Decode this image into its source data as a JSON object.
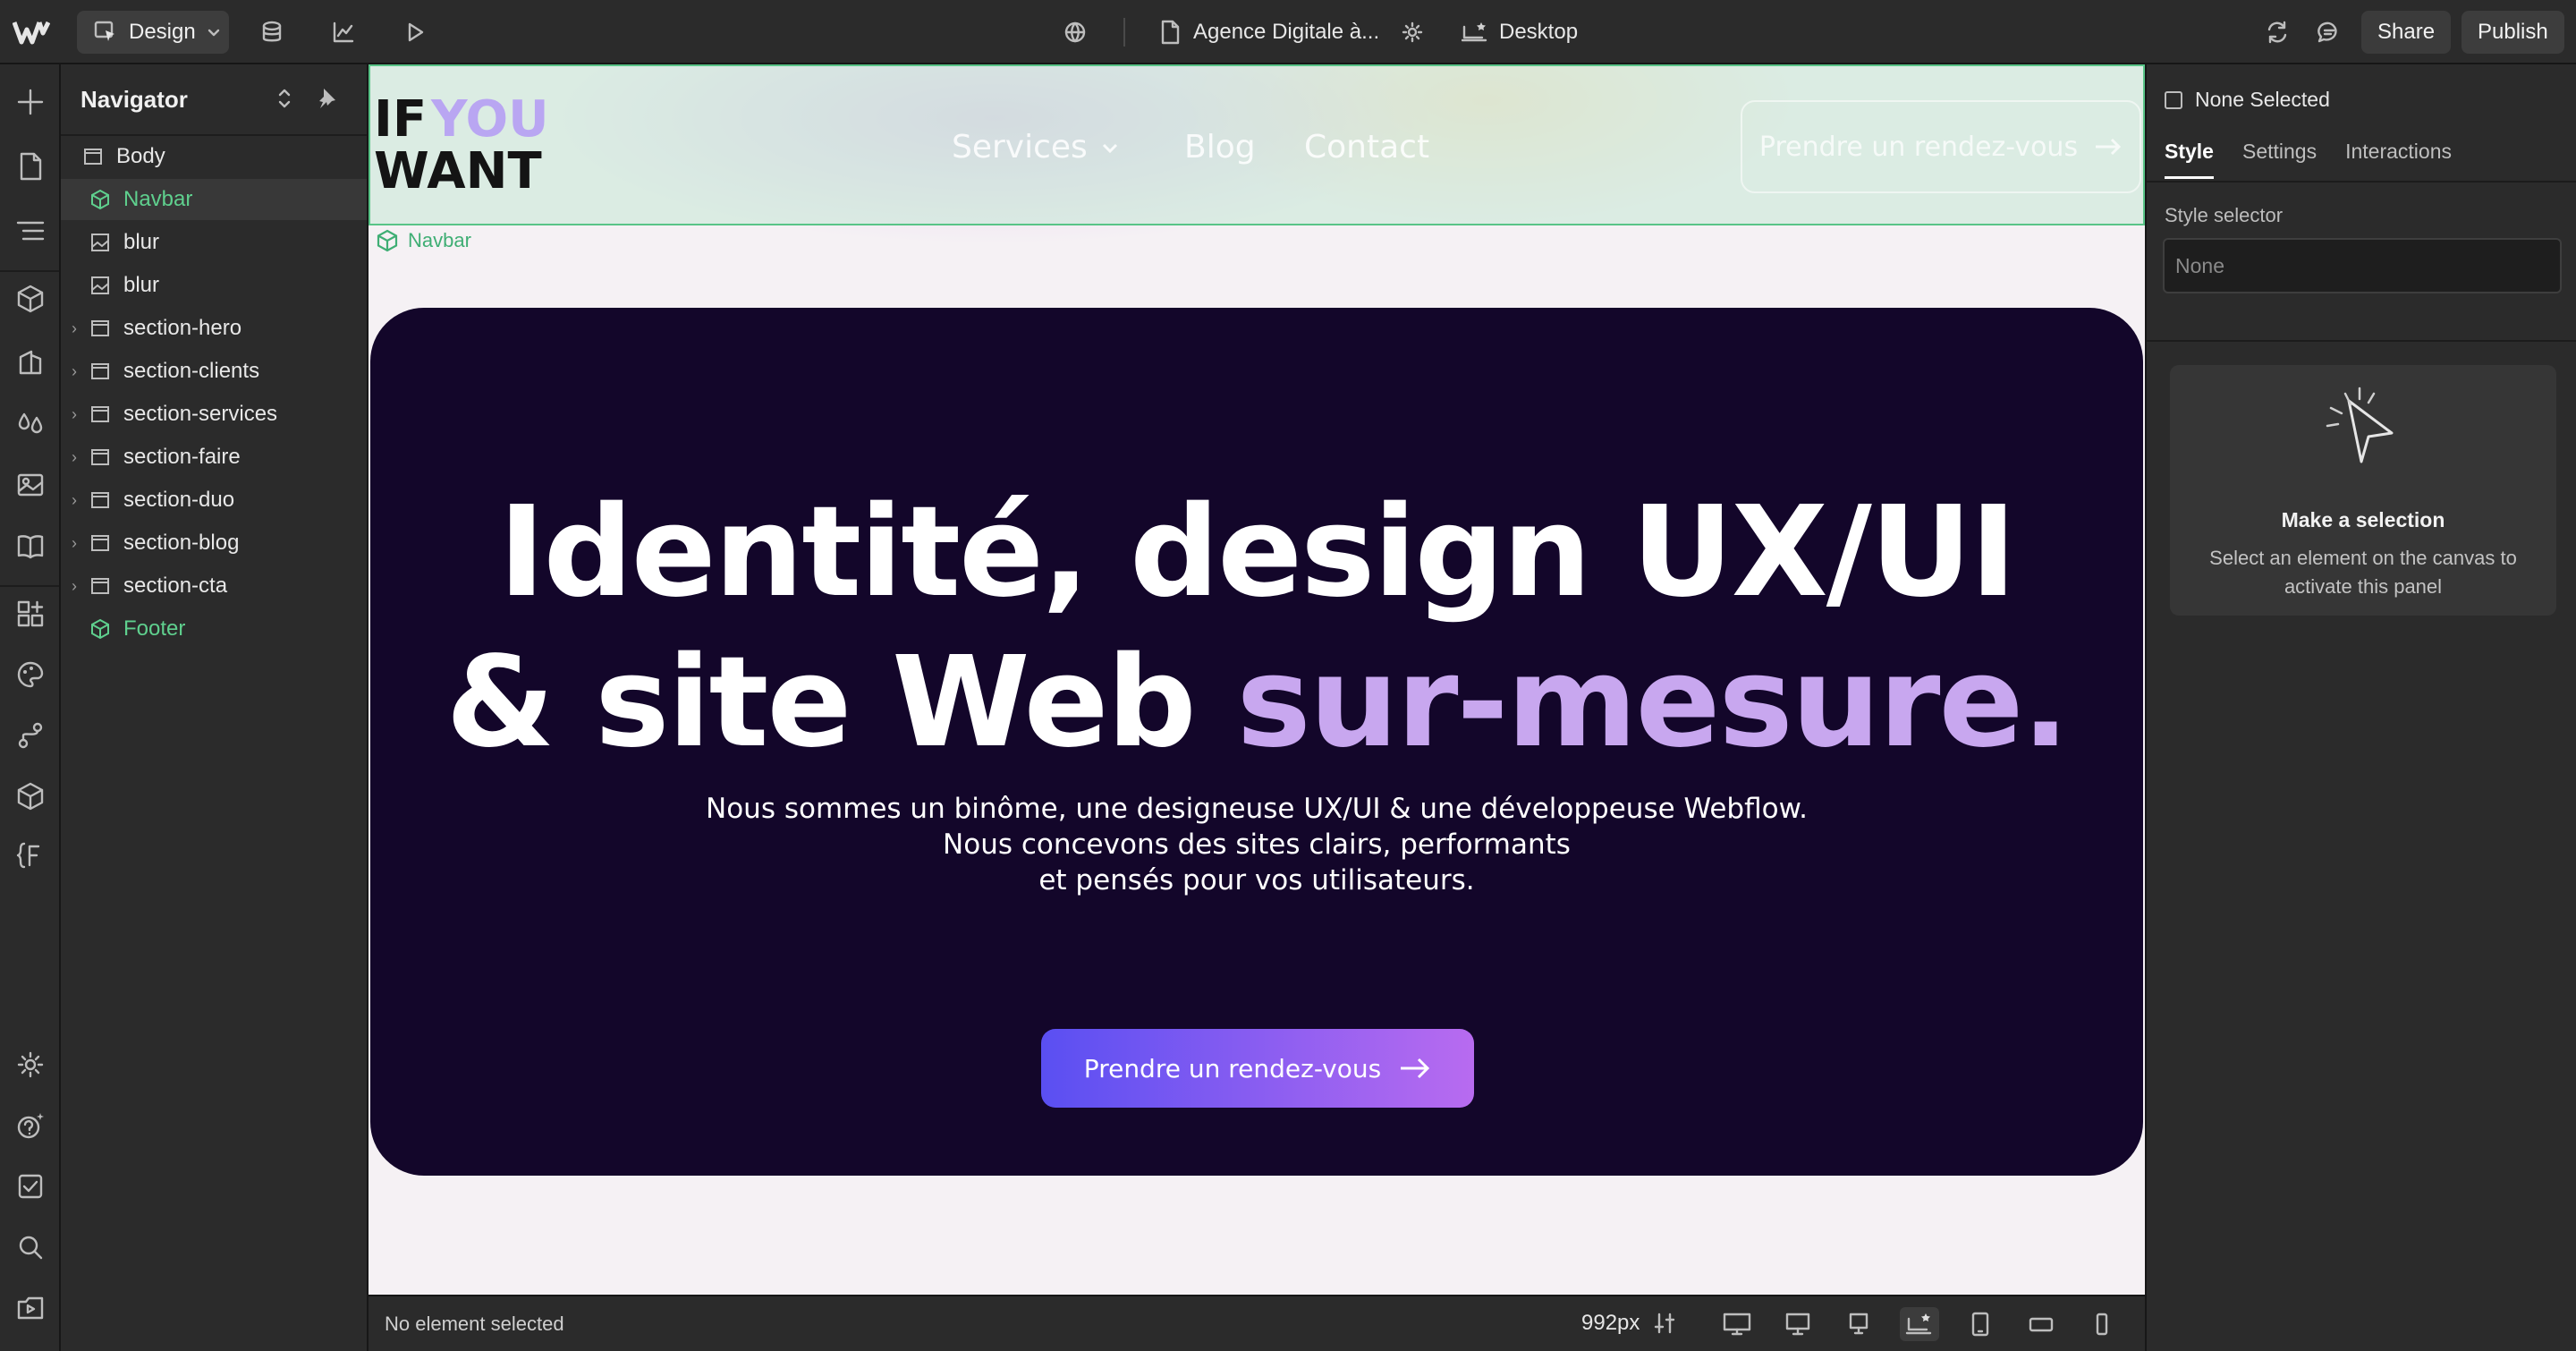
{
  "topbar": {
    "mode_label": "Design",
    "page_name": "Agence Digitale à...",
    "breakpoint_label": "Desktop",
    "share_label": "Share",
    "publish_label": "Publish"
  },
  "navigator": {
    "title": "Navigator",
    "items": [
      {
        "label": "Body",
        "type": "box",
        "expandable": false
      },
      {
        "label": "Navbar",
        "type": "component",
        "expandable": false,
        "selected": true
      },
      {
        "label": "blur",
        "type": "image",
        "expandable": false
      },
      {
        "label": "blur",
        "type": "image",
        "expandable": false
      },
      {
        "label": "section-hero",
        "type": "box",
        "expandable": true
      },
      {
        "label": "section-clients",
        "type": "box",
        "expandable": true
      },
      {
        "label": "section-services",
        "type": "box",
        "expandable": true
      },
      {
        "label": "section-faire",
        "type": "box",
        "expandable": true
      },
      {
        "label": "section-duo",
        "type": "box",
        "expandable": true
      },
      {
        "label": "section-blog",
        "type": "box",
        "expandable": true
      },
      {
        "label": "section-cta",
        "type": "box",
        "expandable": true
      },
      {
        "label": "Footer",
        "type": "component",
        "expandable": false
      }
    ]
  },
  "canvas": {
    "logo_line1_a": "IF",
    "logo_line1_b": "YOU",
    "logo_line2": "WANT",
    "nav_links": [
      "Services",
      "Blog",
      "Contact"
    ],
    "nav_cta": "Prendre un rendez-vous",
    "navbar_badge": "Navbar",
    "hero_line1": "Identité, design UX/UI",
    "hero_line2_plain": "& site Web ",
    "hero_line2_accent": "sur-mesure.",
    "hero_sub_1": "Nous sommes un binôme, une designeuse UX/UI & une développeuse Webflow.",
    "hero_sub_2": "Nous concevons des sites clairs, performants",
    "hero_sub_3": "et pensés pour vos utilisateurs.",
    "hero_button": "Prendre un rendez-vous"
  },
  "statusbar": {
    "status_text": "No element selected",
    "width_readout": "992px"
  },
  "right_panel": {
    "selection_label": "None Selected",
    "tabs": [
      "Style",
      "Settings",
      "Interactions"
    ],
    "style_selector_label": "Style selector",
    "style_selector_placeholder": "None",
    "empty_title": "Make a selection",
    "empty_desc": "Select an element on the canvas to activate this panel"
  },
  "colors": {
    "accent_green": "#5fd08e",
    "hero_bg": "#13062a",
    "hero_accent": "#c8a7ef",
    "button_gradient_start": "#5a4ff2",
    "button_gradient_end": "#b86bf0"
  }
}
